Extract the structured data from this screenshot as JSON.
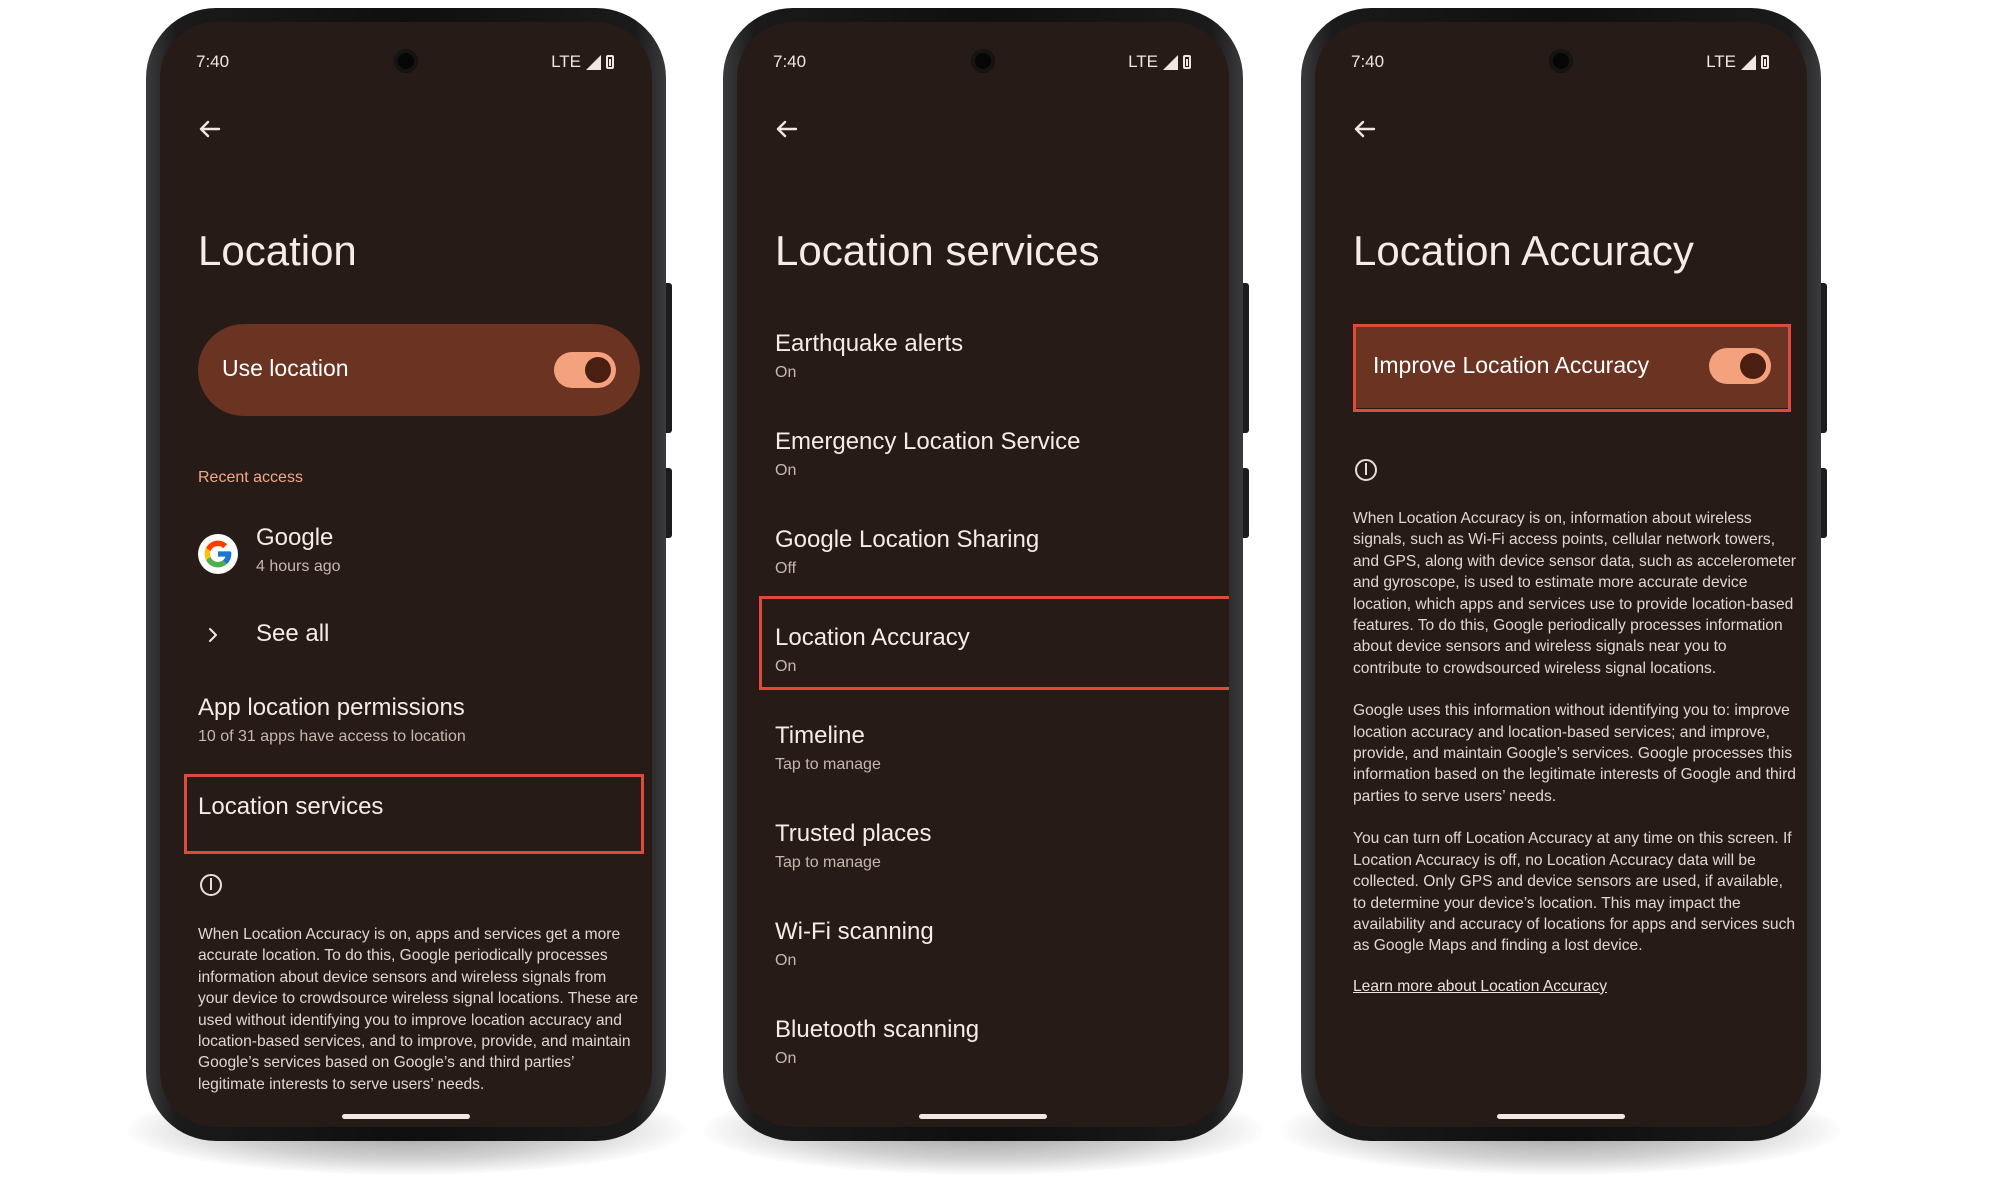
{
  "colors": {
    "screen_bg": "#271b17",
    "toggle_card_bg": "#6a3322",
    "switch_on": "#f4a27d",
    "accent_text": "#f0a98b",
    "highlight_border": "#e04a3a"
  },
  "status": {
    "time": "7:40",
    "network": "LTE"
  },
  "phone1": {
    "title": "Location",
    "toggle_label": "Use location",
    "toggle_on": true,
    "recent_access_label": "Recent access",
    "recent_app": {
      "name": "Google",
      "time": "4 hours ago",
      "icon": "google-icon"
    },
    "see_all": "See all",
    "app_permissions": {
      "title": "App location permissions",
      "subtitle": "10 of 31 apps have access to location"
    },
    "location_services": "Location services",
    "info_text": "When Location Accuracy is on, apps and services get a more accurate location. To do this, Google periodically processes information about device sensors and wireless signals from your device to crowdsource wireless signal locations. These are used without identifying you to improve location accuracy and location-based services, and to improve, provide, and maintain Google’s services based on Google’s and third parties’ legitimate interests to serve users’ needs."
  },
  "phone2": {
    "title": "Location services",
    "items": [
      {
        "title": "Earthquake alerts",
        "status": "On"
      },
      {
        "title": "Emergency Location Service",
        "status": "On"
      },
      {
        "title": "Google Location Sharing",
        "status": "Off"
      },
      {
        "title": "Location Accuracy",
        "status": "On"
      },
      {
        "title": "Timeline",
        "status": "Tap to manage"
      },
      {
        "title": "Trusted places",
        "status": "Tap to manage"
      },
      {
        "title": "Wi-Fi scanning",
        "status": "On"
      },
      {
        "title": "Bluetooth scanning",
        "status": "On"
      }
    ]
  },
  "phone3": {
    "title": "Location Accuracy",
    "toggle_label": "Improve Location Accuracy",
    "toggle_on": true,
    "para1": "When Location Accuracy is on, information about wireless signals, such as Wi-Fi access points, cellular network towers, and GPS, along with device sensor data, such as accelerometer and gyroscope, is used to estimate more accurate device location, which apps and services use to provide location-based features. To do this, Google periodically processes information about device sensors and wireless signals near you to contribute to crowdsourced wireless signal locations.",
    "para2": "Google uses this information without identifying you to: improve location accuracy and location-based services; and improve, provide, and maintain Google’s services. Google processes this information based on the legitimate interests of Google and third parties to serve users’ needs.",
    "para3": "You can turn off Location Accuracy at any time on this screen. If Location Accuracy is off, no Location Accuracy data will be collected. Only GPS and device sensors are used, if available, to determine your device’s location. This may impact the availability and accuracy of locations for apps and services such as Google Maps and finding a lost device.",
    "learn_more": "Learn more about Location Accuracy"
  }
}
